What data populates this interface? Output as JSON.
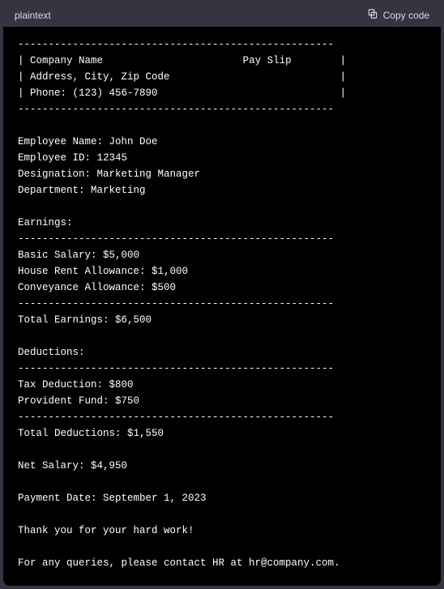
{
  "topbar": {
    "lang_label": "plaintext",
    "copy_label": "Copy code"
  },
  "hr": "----------------------------------------------------",
  "header": {
    "company": "Company Name",
    "title": "Pay Slip",
    "address": "Address, City, Zip Code",
    "phone": "Phone: (123) 456-7890"
  },
  "employee": {
    "name_label": "Employee Name",
    "name": "John Doe",
    "id_label": "Employee ID",
    "id": "12345",
    "designation_label": "Designation",
    "designation": "Marketing Manager",
    "department_label": "Department",
    "department": "Marketing"
  },
  "earnings": {
    "heading": "Earnings:",
    "items": [
      {
        "label": "Basic Salary",
        "value": "$5,000"
      },
      {
        "label": "House Rent Allowance",
        "value": "$1,000"
      },
      {
        "label": "Conveyance Allowance",
        "value": "$500"
      }
    ],
    "total_label": "Total Earnings",
    "total": "$6,500"
  },
  "deductions": {
    "heading": "Deductions:",
    "items": [
      {
        "label": "Tax Deduction",
        "value": "$800"
      },
      {
        "label": "Provident Fund",
        "value": "$750"
      }
    ],
    "total_label": "Total Deductions",
    "total": "$1,550"
  },
  "net": {
    "label": "Net Salary",
    "value": "$4,950"
  },
  "payment": {
    "label": "Payment Date",
    "value": "September 1, 2023"
  },
  "footer": {
    "thanks": "Thank you for your hard work!",
    "contact": "For any queries, please contact HR at hr@company.com."
  }
}
